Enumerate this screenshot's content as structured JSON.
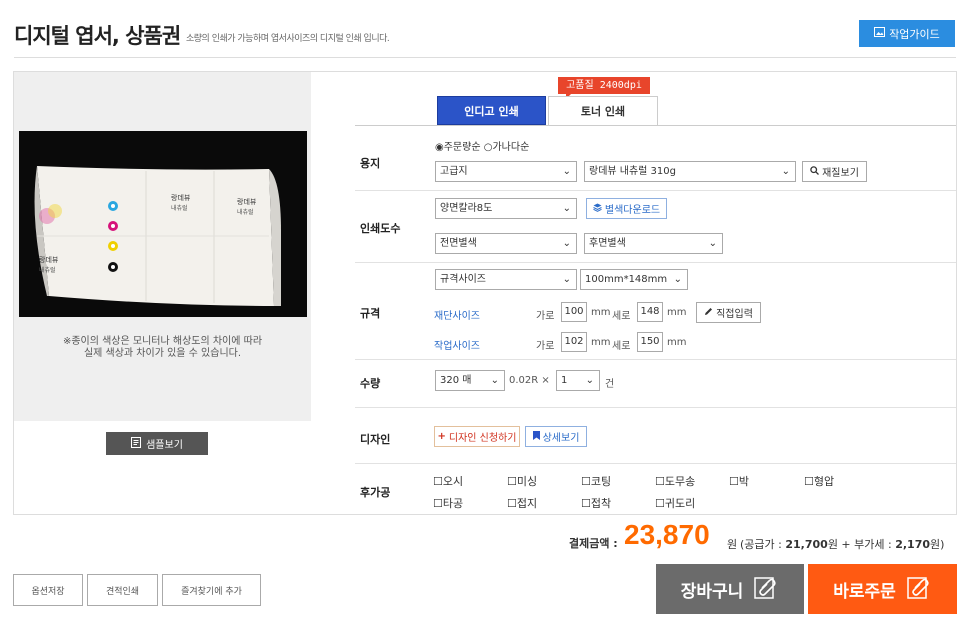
{
  "header": {
    "title": "디지털 엽서, 상품권",
    "subtitle": "소량의 인쇄가 가능하며 엽서사이즈의 디지털 인쇄 입니다.",
    "guide_button": "작업가이드"
  },
  "preview": {
    "card_brand_1": "랑데뷰",
    "card_brand_1_sub": "내츄럴",
    "card_brand_2": "랑데뷰",
    "card_brand_2_sub": "내츄럴",
    "card_brand_3": "랑데뷰",
    "card_brand_3_sub": "내츄럴",
    "note_line1": "※종이의 색상은 모니터나 해상도의 차이에 따라",
    "note_line2": "실제 색상과 차이가 있을 수 있습니다.",
    "sample_button": "샘플보기"
  },
  "tabs": {
    "badge": "고품질 2400dpi",
    "tab1": "인디고 인쇄",
    "tab2": "토너 인쇄"
  },
  "paper": {
    "label": "용지",
    "radio1": "주문량순",
    "radio2": "가나다순",
    "select1": "고급지",
    "select2": "랑데뷰 내츄럴 310g",
    "view_button": "재질보기"
  },
  "print": {
    "label": "인쇄도수",
    "select1": "양면칼라8도",
    "download_button": "별색다운로드",
    "select2": "전면별색",
    "select3": "후면별색"
  },
  "size": {
    "label": "규격",
    "select1": "규격사이즈",
    "select2": "100mm*148mm",
    "cut_label": "재단사이즈",
    "work_label": "작업사이즈",
    "width_label": "가로",
    "height_label": "세로",
    "unit": "mm",
    "cut_width": "100",
    "cut_height": "148",
    "work_width": "102",
    "work_height": "150",
    "direct_button": "직접입력"
  },
  "quantity": {
    "label": "수량",
    "select1": "320 매",
    "multiplier": "0.02R ×",
    "select2": "1",
    "unit": "건"
  },
  "design": {
    "label": "디자인",
    "apply_button": "디자인 신청하기",
    "detail_button": "상세보기"
  },
  "post": {
    "label": "후가공",
    "options": [
      "오시",
      "미싱",
      "코팅",
      "도무송",
      "박",
      "형압",
      "타공",
      "접지",
      "접착",
      "귀도리"
    ]
  },
  "total": {
    "label": "결제금액 :",
    "price": "23,870",
    "unit": "원",
    "detail_prefix": "(공급가 :",
    "supply": "21,700",
    "detail_mid": "원 + 부가세 :",
    "vat": "2,170",
    "detail_suffix": "원)"
  },
  "bottom": {
    "save": "옵션저장",
    "estimate": "견적인쇄",
    "favorite": "즐겨찾기에 추가",
    "cart": "장바구니",
    "order": "바로주문"
  },
  "colors": {
    "accent_blue": "#2b54c8",
    "orange": "#ff5a12",
    "price": "#ff6a00"
  }
}
